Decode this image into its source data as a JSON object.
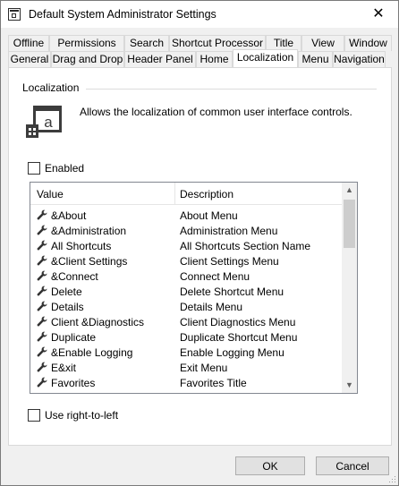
{
  "window": {
    "title": "Default System Administrator Settings",
    "close_label": "✕"
  },
  "tabs_row1": [
    "Offline",
    "Permissions",
    "Search",
    "Shortcut Processor",
    "Title",
    "View",
    "Window"
  ],
  "tabs_row2": [
    "General",
    "Drag and Drop",
    "Header Panel",
    "Home",
    "Localization",
    "Menu",
    "Navigation"
  ],
  "active_tab": "Localization",
  "group": {
    "label": "Localization",
    "description": "Allows the localization of common user interface controls."
  },
  "enabled": {
    "label": "Enabled",
    "checked": false
  },
  "list": {
    "columns": [
      "Value",
      "Description"
    ],
    "rows": [
      {
        "value": "&About",
        "description": "About Menu"
      },
      {
        "value": "&Administration",
        "description": "Administration Menu"
      },
      {
        "value": "All Shortcuts",
        "description": "All Shortcuts Section Name"
      },
      {
        "value": "&Client Settings",
        "description": "Client Settings Menu"
      },
      {
        "value": "&Connect",
        "description": "Connect Menu"
      },
      {
        "value": "Delete",
        "description": "Delete Shortcut Menu"
      },
      {
        "value": "Details",
        "description": "Details Menu"
      },
      {
        "value": "Client &Diagnostics",
        "description": "Client Diagnostics Menu"
      },
      {
        "value": "Duplicate",
        "description": "Duplicate Shortcut Menu"
      },
      {
        "value": "&Enable Logging",
        "description": "Enable Logging Menu"
      },
      {
        "value": "E&xit",
        "description": "Exit Menu"
      },
      {
        "value": "Favorites",
        "description": "Favorites Title"
      }
    ],
    "row_icon": "wrench-icon"
  },
  "rtl": {
    "label": "Use right-to-left",
    "checked": false
  },
  "buttons": {
    "ok": "OK",
    "cancel": "Cancel"
  },
  "colors": {
    "title_bg": "#ffffff",
    "panel_bg": "#ffffff",
    "window_bg": "#f0f0f0",
    "icon_dark": "#3c3c3c"
  }
}
